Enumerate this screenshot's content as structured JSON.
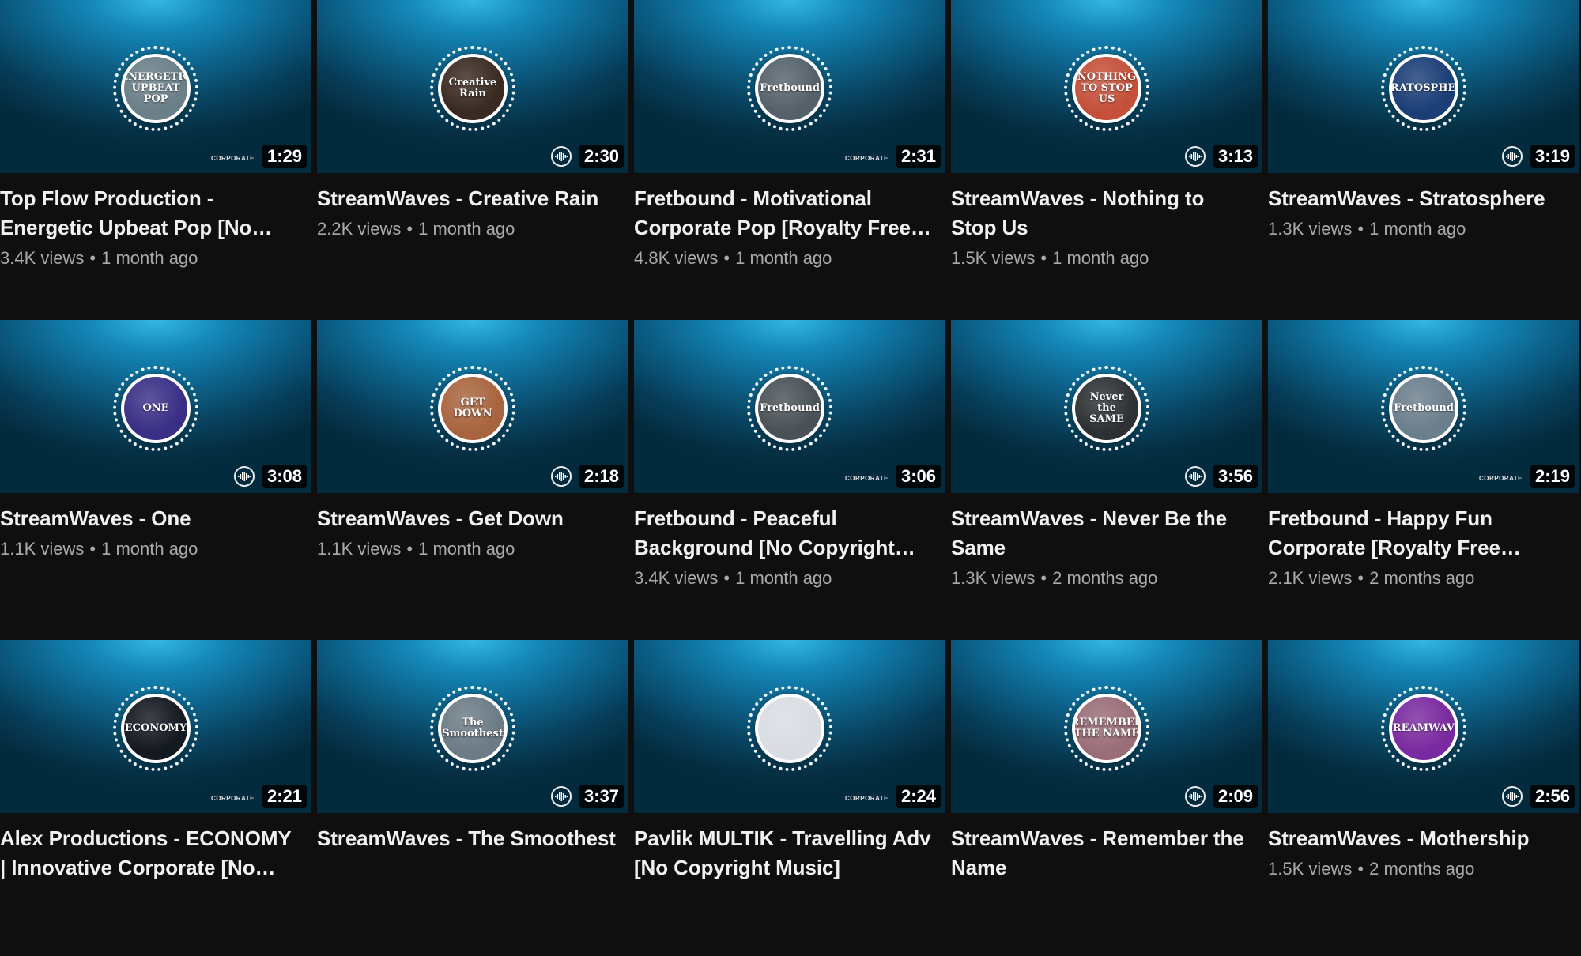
{
  "videos": [
    {
      "title": "Top Flow Production - Energetic Upbeat Pop [No Copyright Music]",
      "views": "3.4K views",
      "age": "1 month ago",
      "duration": "1:29",
      "disc_text": "ENERGETIC UPBEAT POP",
      "disc_color": "#6a7f88",
      "channel_logo": "CORPORATE",
      "logo_type": "text"
    },
    {
      "title": "StreamWaves - Creative Rain",
      "views": "2.2K views",
      "age": "1 month ago",
      "duration": "2:30",
      "disc_text": "Creative Rain",
      "disc_color": "#3a2a22",
      "channel_logo": "",
      "logo_type": "wave"
    },
    {
      "title": "Fretbound - Motivational Corporate Pop [Royalty Free Music]",
      "views": "4.8K views",
      "age": "1 month ago",
      "duration": "2:31",
      "disc_text": "Fretbound",
      "disc_color": "#55616a",
      "channel_logo": "CORPORATE",
      "logo_type": "text"
    },
    {
      "title": "StreamWaves - Nothing to Stop Us",
      "views": "1.5K views",
      "age": "1 month ago",
      "duration": "3:13",
      "disc_text": "NOTHING TO STOP US",
      "disc_color": "#c4503a",
      "channel_logo": "",
      "logo_type": "wave"
    },
    {
      "title": "StreamWaves - Stratosphere",
      "views": "1.3K views",
      "age": "1 month ago",
      "duration": "3:19",
      "disc_text": "STRATOSPHERE",
      "disc_color": "#1b3e77",
      "channel_logo": "",
      "logo_type": "wave"
    },
    {
      "title": "StreamWaves - One",
      "views": "1.1K views",
      "age": "1 month ago",
      "duration": "3:08",
      "disc_text": "ONE",
      "disc_color": "#3a2f86",
      "channel_logo": "",
      "logo_type": "wave"
    },
    {
      "title": "StreamWaves - Get Down",
      "views": "1.1K views",
      "age": "1 month ago",
      "duration": "2:18",
      "disc_text": "GET DOWN",
      "disc_color": "#a8643e",
      "channel_logo": "",
      "logo_type": "wave"
    },
    {
      "title": "Fretbound - Peaceful Background [No Copyright Music]",
      "views": "3.4K views",
      "age": "1 month ago",
      "duration": "3:06",
      "disc_text": "Fretbound",
      "disc_color": "#4a5257",
      "channel_logo": "CORPORATE",
      "logo_type": "text"
    },
    {
      "title": "StreamWaves - Never Be the Same",
      "views": "1.3K views",
      "age": "2 months ago",
      "duration": "3:56",
      "disc_text": "Never the SAME",
      "disc_color": "#2d3134",
      "channel_logo": "",
      "logo_type": "wave"
    },
    {
      "title": "Fretbound - Happy Fun Corporate [Royalty Free Music]",
      "views": "2.1K views",
      "age": "2 months ago",
      "duration": "2:19",
      "disc_text": "Fretbound",
      "disc_color": "#6b7e8c",
      "channel_logo": "CORPORATE",
      "logo_type": "text"
    },
    {
      "title": "Alex Productions - ECONOMY | Innovative Corporate [No Copyright Music]",
      "views": "",
      "age": "",
      "duration": "2:21",
      "disc_text": "ECONOMY",
      "disc_color": "#141820",
      "channel_logo": "CORPORATE",
      "logo_type": "text"
    },
    {
      "title": "StreamWaves - The Smoothest",
      "views": "",
      "age": "",
      "duration": "3:37",
      "disc_text": "The Smoothest",
      "disc_color": "#6c7b86",
      "channel_logo": "",
      "logo_type": "wave"
    },
    {
      "title": "Pavlik MULTIK - Travelling Adv [No Copyright Music]",
      "views": "",
      "age": "",
      "duration": "2:24",
      "disc_text": "",
      "disc_color": "#d9dde3",
      "channel_logo": "CORPORATE",
      "logo_type": "text"
    },
    {
      "title": "StreamWaves - Remember the Name",
      "views": "",
      "age": "",
      "duration": "2:09",
      "disc_text": "REMEMBER THE NAME",
      "disc_color": "#9a6e78",
      "channel_logo": "",
      "logo_type": "wave"
    },
    {
      "title": "StreamWaves - Mothership",
      "views": "1.5K views",
      "age": "2 months ago",
      "duration": "2:56",
      "disc_text": "STREAMWAVES",
      "disc_color": "#7a2aa0",
      "channel_logo": "",
      "logo_type": "wave"
    }
  ],
  "meta_separator": "•"
}
